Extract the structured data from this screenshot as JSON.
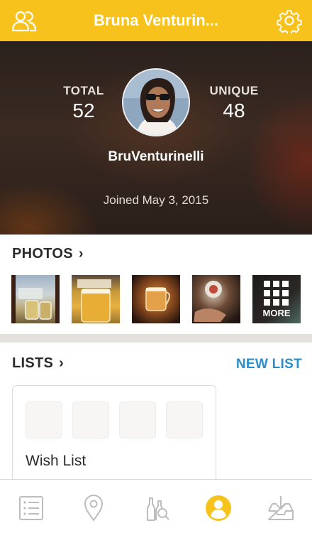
{
  "header": {
    "title": "Bruna Venturin...",
    "friends_icon": "friends-icon",
    "settings_icon": "gear-icon",
    "background": "#f7c21c"
  },
  "profile": {
    "total_label": "TOTAL",
    "total_value": "52",
    "unique_label": "UNIQUE",
    "unique_value": "48",
    "username": "BruVenturinelli",
    "joined": "Joined May 3, 2015"
  },
  "photos": {
    "heading": "PHOTOS",
    "chevron": "›",
    "more_label": "MORE",
    "thumbnails": [
      "beer-glass-photo",
      "beer-mug-photo",
      "beer-pint-photo",
      "beer-hand-photo"
    ]
  },
  "lists": {
    "heading": "LISTS",
    "chevron": "›",
    "new_list_label": "NEW LIST",
    "cards": [
      {
        "title": "Wish List"
      }
    ]
  },
  "tabbar": {
    "items": [
      "feed-icon",
      "location-pin-icon",
      "bottles-search-icon",
      "profile-icon",
      "inbox-download-icon"
    ],
    "active_color": "#f7c21c",
    "inactive_color": "#bdbdbd"
  },
  "colors": {
    "accent": "#f7c21c",
    "link": "#2a8fc9"
  }
}
